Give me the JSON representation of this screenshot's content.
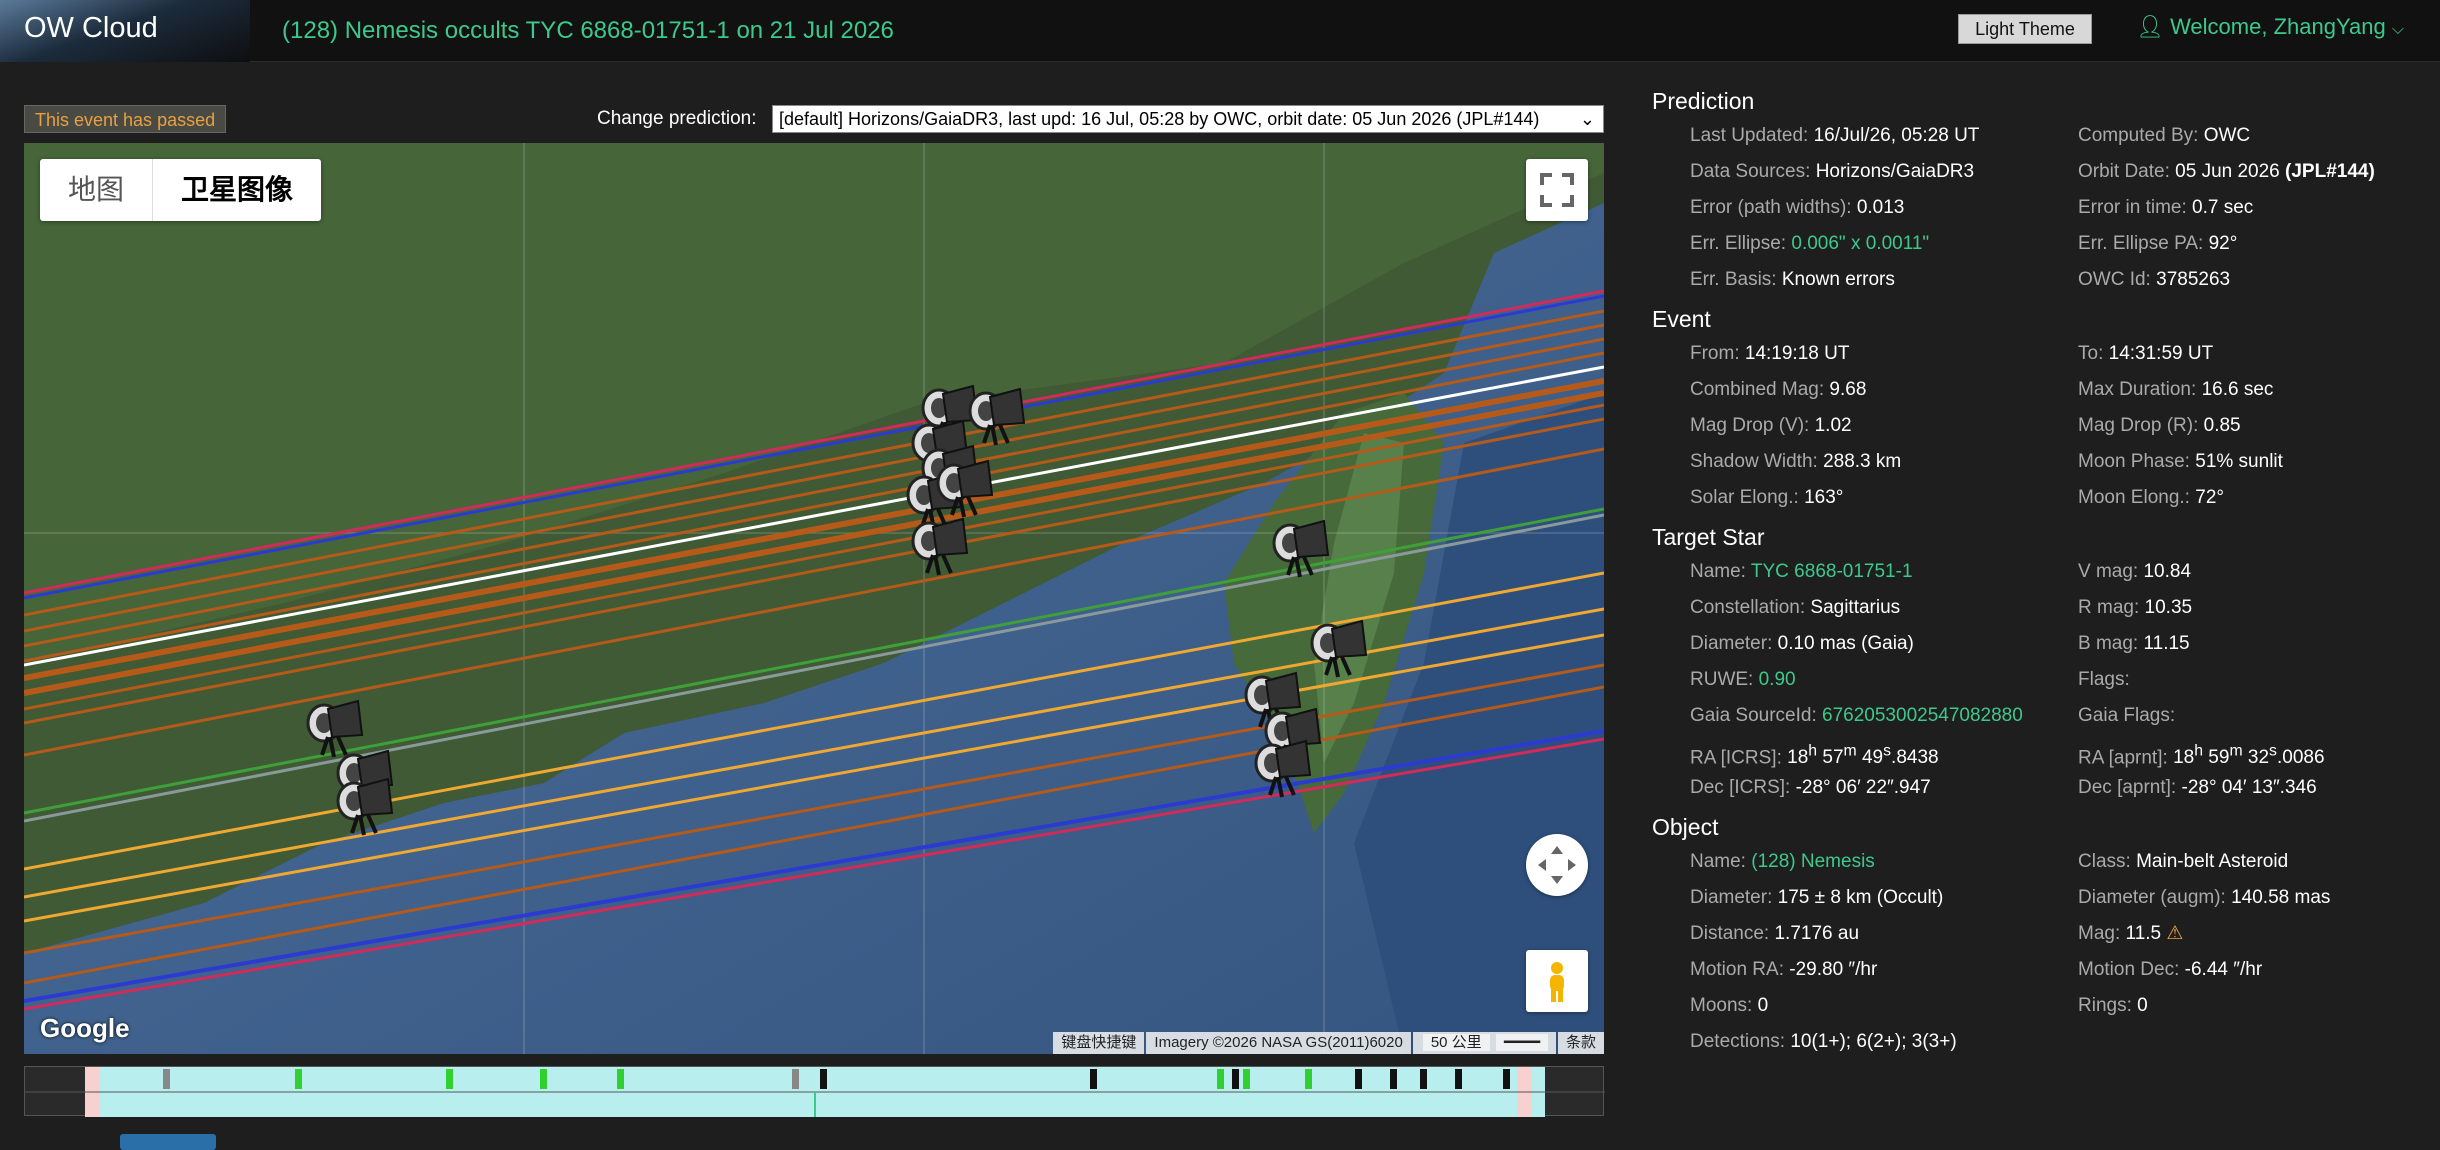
{
  "brand": "OW Cloud",
  "event_title": "(128) Nemesis occults TYC 6868-01751-1 on 21 Jul 2026",
  "theme_button": "Light Theme",
  "welcome": "Welcome, ZhangYang",
  "passed_notice": "This event has passed",
  "change_prediction_label": "Change prediction:",
  "prediction_select": "[default] Horizons/GaiaDR3, last upd: 16 Jul, 05:28 by OWC, orbit date: 05 Jun 2026 (JPL#144)",
  "map": {
    "type_map": "地图",
    "type_satellite": "卫星图像",
    "google": "Google",
    "attrib_shortcuts": "键盘快捷键",
    "attrib_imagery": "Imagery ©2026 NASA GS(2011)6020",
    "attrib_scale": "50 公里",
    "attrib_terms": "条款"
  },
  "colors": {
    "accent": "#3ec98c",
    "warning": "#e8a040"
  },
  "sections": {
    "prediction": "Prediction",
    "event": "Event",
    "target": "Target Star",
    "object": "Object"
  },
  "prediction": {
    "last_updated_l": "Last Updated:",
    "last_updated": "16/Jul/26, 05:28 UT",
    "computed_by_l": "Computed By:",
    "computed_by": "OWC",
    "sources_l": "Data Sources:",
    "sources": "Horizons/GaiaDR3",
    "orbit_l": "Orbit Date:",
    "orbit": "05 Jun 2026",
    "orbit_jpl": "(JPL#144)",
    "err_path_l": "Error (path widths):",
    "err_path": "0.013",
    "err_time_l": "Error in time:",
    "err_time": "0.7 sec",
    "ellipse_l": "Err. Ellipse:",
    "ellipse": "0.006\" x 0.0011\"",
    "ellipse_pa_l": "Err. Ellipse PA:",
    "ellipse_pa": "92°",
    "basis_l": "Err. Basis:",
    "basis": "Known errors",
    "owcid_l": "OWC Id:",
    "owcid": "3785263"
  },
  "event": {
    "from_l": "From:",
    "from": "14:19:18 UT",
    "to_l": "To:",
    "to": "14:31:59 UT",
    "cmag_l": "Combined Mag:",
    "cmag": "9.68",
    "maxdur_l": "Max Duration:",
    "maxdur": "16.6 sec",
    "dropv_l": "Mag Drop (V):",
    "dropv": "1.02",
    "dropr_l": "Mag Drop (R):",
    "dropr": "0.85",
    "shadow_l": "Shadow Width:",
    "shadow": "288.3 km",
    "moonphase_l": "Moon Phase:",
    "moonphase": "51% sunlit",
    "solar_l": "Solar Elong.:",
    "solar": "163°",
    "moonel_l": "Moon Elong.:",
    "moonel": "72°"
  },
  "target": {
    "name_l": "Name:",
    "name": "TYC 6868-01751-1",
    "vmag_l": "V mag:",
    "vmag": "10.84",
    "const_l": "Constellation:",
    "const": "Sagittarius",
    "rmag_l": "R mag:",
    "rmag": "10.35",
    "diam_l": "Diameter:",
    "diam": "0.10 mas  (Gaia)",
    "bmag_l": "B mag:",
    "bmag": "11.15",
    "ruwe_l": "RUWE:",
    "ruwe": "0.90",
    "flags_l": "Flags:",
    "gaia_l": "Gaia SourceId:",
    "gaia": "6762053002547082880",
    "gflags_l": "Gaia Flags:",
    "ra_l": "RA [ICRS]:",
    "ra_h": "18",
    "ra_m": "57",
    "ra_s": "49",
    "ra_f": ".8438",
    "raa_l": "RA [aprnt]:",
    "raa_h": "18",
    "raa_m": "59",
    "raa_s": "32",
    "raa_f": ".0086",
    "dec_l": "Dec [ICRS]:",
    "dec": "-28° 06′ 22″.947",
    "deca_l": "Dec [aprnt]:",
    "deca": "-28° 04′ 13″.346"
  },
  "object": {
    "name_l": "Name:",
    "name": "(128) Nemesis",
    "class_l": "Class:",
    "class": "Main-belt Asteroid",
    "diam_l": "Diameter:",
    "diam": "175 ± 8 km  (Occult)",
    "diama_l": "Diameter (augm):",
    "diama": "140.58 mas",
    "dist_l": "Distance:",
    "dist": "1.7176 au",
    "mag_l": "Mag:",
    "mag": "11.5",
    "mra_l": "Motion RA:",
    "mra": "-29.80 ″/hr",
    "mdec_l": "Motion Dec:",
    "mdec": "-6.44 ″/hr",
    "moons_l": "Moons:",
    "moons": "0",
    "rings_l": "Rings:",
    "rings": "0",
    "det_l": "Detections:",
    "det": "10(1+); 6(2+); 3(3+)"
  }
}
